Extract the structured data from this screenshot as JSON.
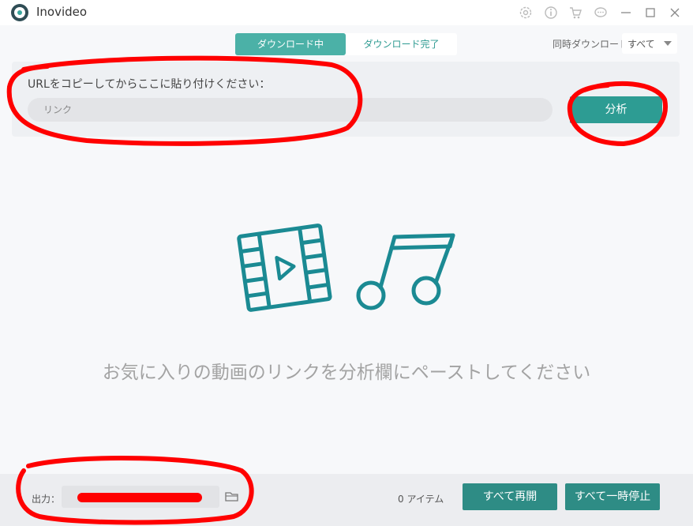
{
  "app": {
    "title": "Inovideo"
  },
  "tabs": [
    {
      "label": "ダウンロード中",
      "active": true
    },
    {
      "label": "ダウンロード完了",
      "active": false
    }
  ],
  "concurrent": {
    "label": "同時ダウンロード",
    "value": "すべて"
  },
  "url_panel": {
    "label": "URLをコピーしてからここに貼り付けください：",
    "placeholder": "リンク",
    "value": "",
    "analyze_label": "分析"
  },
  "empty_state": {
    "message": "お気に入りの動画のリンクを分析欄にペーストしてください"
  },
  "footer": {
    "output_label": "出力：",
    "item_count": "0 アイテム",
    "resume_all": "すべて再開",
    "pause_all": "すべて一時停止"
  },
  "colors": {
    "accent": "#2d9c93",
    "tab_active": "#4bb1a7",
    "annotation": "#ff0000",
    "illustration": "#1b8a93"
  },
  "icons": [
    "app-logo",
    "settings-icon",
    "info-icon",
    "cart-icon",
    "chat-icon",
    "minimize-icon",
    "maximize-icon",
    "close-icon",
    "folder-icon",
    "video-film-icon",
    "music-note-icon"
  ]
}
